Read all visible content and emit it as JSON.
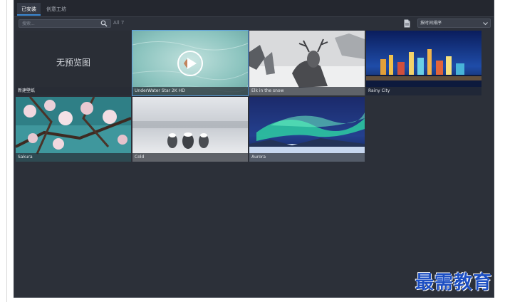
{
  "tabs": [
    {
      "label": "已安装",
      "active": true
    },
    {
      "label": "创意工坊",
      "active": false
    }
  ],
  "toolbar": {
    "search_placeholder": "搜索...",
    "count_label": "All 7",
    "sort_label": "按时间排序"
  },
  "wallpapers": [
    {
      "caption": "新建壁纸",
      "preview_text": "无预览图",
      "has_preview": false
    },
    {
      "caption": "UnderWater Star 2K HD",
      "selected": true,
      "has_play_overlay": true
    },
    {
      "caption": "Elk in the snow"
    },
    {
      "caption": "Rainy City"
    },
    {
      "caption": "Sakura"
    },
    {
      "caption": "Cold"
    },
    {
      "caption": "Aurora"
    }
  ],
  "watermark": "最需教育",
  "colors": {
    "app_background": "#2c3039",
    "tabbar_background": "#24272f",
    "accent": "#3d8bd6",
    "watermark": "#1d4fc2"
  }
}
